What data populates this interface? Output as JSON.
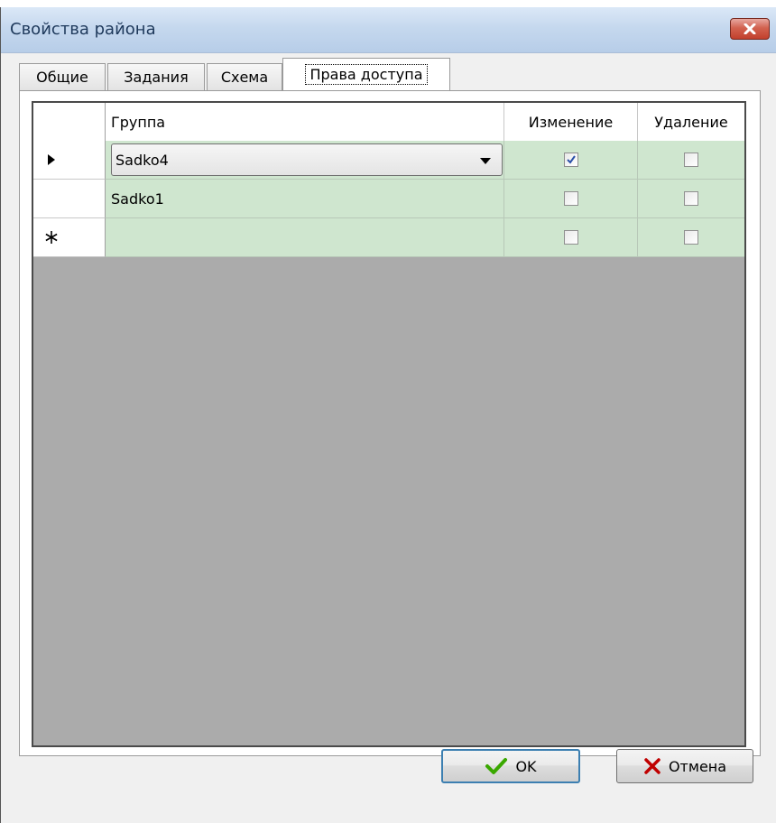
{
  "window": {
    "title": "Свойства района"
  },
  "tabs": [
    {
      "label": "Общие",
      "active": false
    },
    {
      "label": "Задания",
      "active": false
    },
    {
      "label": "Схема",
      "active": false
    },
    {
      "label": "Права доступа",
      "active": true
    }
  ],
  "grid": {
    "columns": {
      "group": "Группа",
      "edit": "Изменение",
      "delete": "Удаление"
    },
    "rows": [
      {
        "indicator": "▶",
        "group": "Sadko4",
        "edit": true,
        "delete": false,
        "editing": true
      },
      {
        "indicator": "",
        "group": "Sadko1",
        "edit": false,
        "delete": false,
        "editing": false
      },
      {
        "indicator": "✱",
        "group": "",
        "edit": false,
        "delete": false,
        "editing": false
      }
    ]
  },
  "buttons": {
    "ok": "OK",
    "cancel": "Отмена"
  },
  "colors": {
    "row_background": "#cfe6cf",
    "grid_empty_area": "#ababab",
    "ok_icon": "#3aa800",
    "cancel_icon": "#c00000"
  },
  "icons": {
    "close": "close-icon",
    "ok": "checkmark-icon",
    "cancel": "x-icon",
    "current_row": "current-row-icon",
    "new_row": "new-row-icon"
  }
}
